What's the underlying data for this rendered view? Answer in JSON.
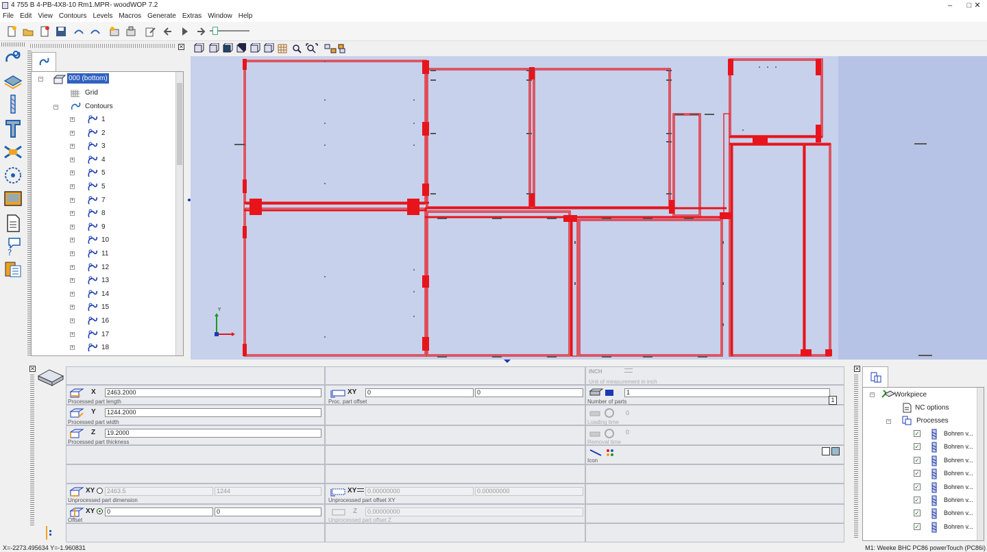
{
  "window": {
    "title": "4 755 B 4-PB-4X8-10 Rm1.MPR- woodWOP 7.2",
    "minimize": "–",
    "maximize": "□",
    "close": "✕"
  },
  "menu": [
    "File",
    "Edit",
    "View",
    "Contours",
    "Levels",
    "Macros",
    "Generate",
    "Extras",
    "Window",
    "Help"
  ],
  "tree": {
    "root": "000 (bottom)",
    "grid": "Grid",
    "contours": "Contours",
    "items": [
      "1",
      "2",
      "3",
      "4",
      "5",
      "5",
      "7",
      "8",
      "9",
      "10",
      "11",
      "12",
      "13",
      "14",
      "15",
      "16",
      "17",
      "18"
    ]
  },
  "props": {
    "x": {
      "label": "X",
      "value": "2463.2000",
      "caption": "Processed part length"
    },
    "y": {
      "label": "Y",
      "value": "1244.2000",
      "caption": "Processed part width"
    },
    "z": {
      "label": "Z",
      "value": "19.2000",
      "caption": "Processed part thickness"
    },
    "unproc_dim": {
      "label": "XY",
      "v1": "2463.5",
      "v2": "1244",
      "caption": "Unprocessed part dimension"
    },
    "offset": {
      "label": "XY",
      "v1": "0",
      "v2": "0",
      "caption": "Offset"
    },
    "proc_offset": {
      "label": "XY",
      "v1": "0",
      "v2": "0",
      "caption": "Proc. part offset"
    },
    "unproc_offset_xy": {
      "label": "XY",
      "v1": "0.00000000",
      "v2": "0.00000000",
      "caption": "Unprocessed part offset XY"
    },
    "unproc_offset_z": {
      "label": "Z",
      "v1": "0.00000000",
      "caption": "Unprocessed part offset Z"
    },
    "unit": {
      "label": "INCH",
      "caption": "Unit of measurement in inch"
    },
    "parts": {
      "value": "1",
      "caption": "Number of parts",
      "badge": "1"
    },
    "loading": {
      "value": "0",
      "caption": "Loading time"
    },
    "removal": {
      "value": "0",
      "caption": "Removal time"
    },
    "icon": {
      "caption": "Icon"
    }
  },
  "rtree": {
    "workpiece": "Workpiece",
    "nc": "NC options",
    "processes": "Processes",
    "items": [
      "Bohren v...",
      "Bohren v...",
      "Bohren v...",
      "Bohren v...",
      "Bohren v...",
      "Bohren v...",
      "Bohren v...",
      "Bohren v..."
    ]
  },
  "status": {
    "coords": "X=-2273.495634 Y=-1.960831",
    "machine": "M1: Weeke BHC PC86 powerTouch (PC86i)"
  },
  "colors": {
    "canvas": "#c7d1ec",
    "canvas_outer": "#b7c3e6",
    "contour": "#e8141b",
    "accent": "#1a5fb4"
  }
}
